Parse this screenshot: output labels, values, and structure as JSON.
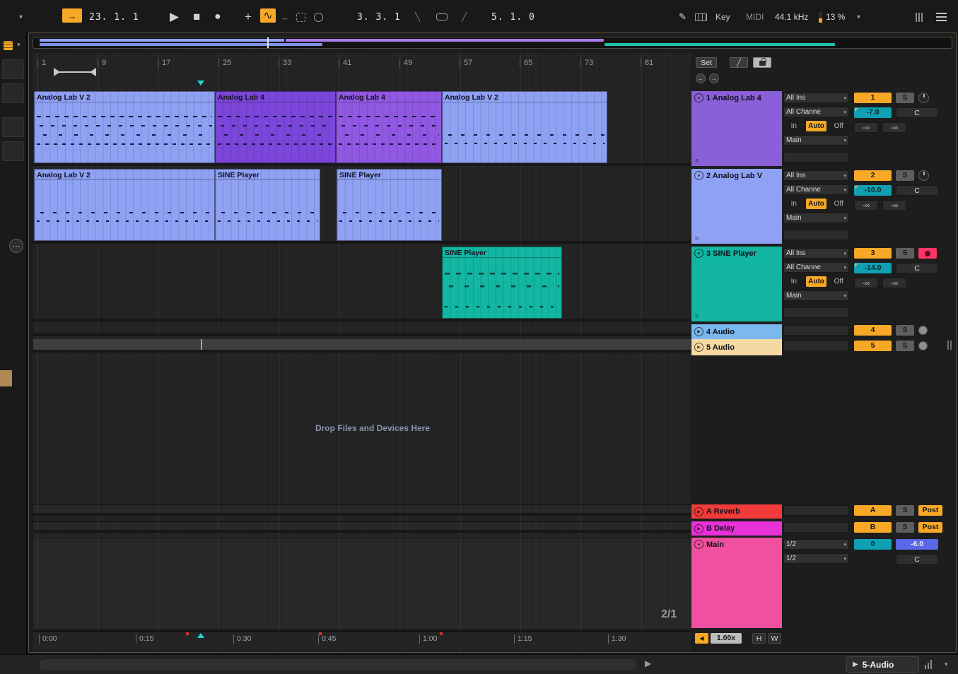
{
  "icons": {
    "caret": "▾",
    "follow": "→",
    "play": "▶",
    "stop": "■",
    "record": "●",
    "plus": "+",
    "automation": "∿",
    "back_arrow": "←",
    "punch_in": "╲",
    "punch_out": "╱",
    "pencil": "✎",
    "dots": "⋯",
    "nav_back": "←",
    "nav_fwd": "→",
    "diagonal": "╱",
    "speaker": "◀",
    "row_play": "▶",
    "lines": "≡"
  },
  "transport": {
    "position": "23. 1. 1",
    "punch_position": "3. 3. 1",
    "loop_length": "5. 1. 0",
    "key": "Key",
    "midi": "MIDI",
    "sample_rate": "44.1 kHz",
    "cpu": "13 %"
  },
  "ruler": {
    "bars": [
      "1",
      "9",
      "17",
      "25",
      "33",
      "41",
      "49",
      "57",
      "65",
      "73",
      "81"
    ]
  },
  "time_ruler": [
    "0:00",
    "0:15",
    "0:30",
    "0:45",
    "1:00",
    "1:15",
    "1:30"
  ],
  "clips": {
    "row1": [
      "Analog Lab V 2",
      "Analog Lab 4",
      "Analog Lab 4",
      "Analog Lab V 2"
    ],
    "row2": [
      "Analog Lab V 2",
      "SINE Player",
      "SINE Player"
    ],
    "row3": [
      "SINE Player"
    ]
  },
  "labels": {
    "set": "Set",
    "input": "All Ins",
    "channel": "All Channe",
    "mon_in": "In",
    "mon_auto": "Auto",
    "mon_off": "Off",
    "output": "Main",
    "solo": "S",
    "pan_center": "C",
    "send": "-∞",
    "post": "Post",
    "half": "1/2",
    "drop_hint": "Drop Files and Devices Here",
    "zoom": "2/1",
    "speed": "1.00x",
    "h": "H",
    "w": "W"
  },
  "tracks": [
    {
      "name": "1 Analog Lab 4",
      "num": "1",
      "vol": "-7.0"
    },
    {
      "name": "2 Analog Lab V",
      "num": "2",
      "vol": "-10.0"
    },
    {
      "name": "3 SINE Player",
      "num": "3",
      "vol": "-14.0"
    },
    {
      "name": "4 Audio",
      "num": "4"
    },
    {
      "name": "5 Audio",
      "num": "5"
    }
  ],
  "returns": [
    {
      "name": "A Reverb",
      "num": "A"
    },
    {
      "name": "B Delay",
      "num": "B"
    }
  ],
  "main_track": {
    "name": "Main",
    "pos": "0",
    "vol": "-6.0"
  },
  "status_bar": {
    "selected_track": "5-Audio"
  },
  "colors": {
    "accent_orange": "#f7a827",
    "clip_blue": "#8fa1f3",
    "clip_purple_dark": "#7b46d9",
    "clip_purple": "#9158e2",
    "clip_teal": "#12b6a2",
    "track4_blue": "#7ab8ee",
    "track5_cream": "#f6d9a2",
    "return_red": "#f23b3b",
    "return_magenta": "#e832d8",
    "main_pink": "#f0509f",
    "value_teal": "#0fa0b2",
    "value_blue": "#5a67e8",
    "playhead_cyan": "#25d6d6"
  }
}
